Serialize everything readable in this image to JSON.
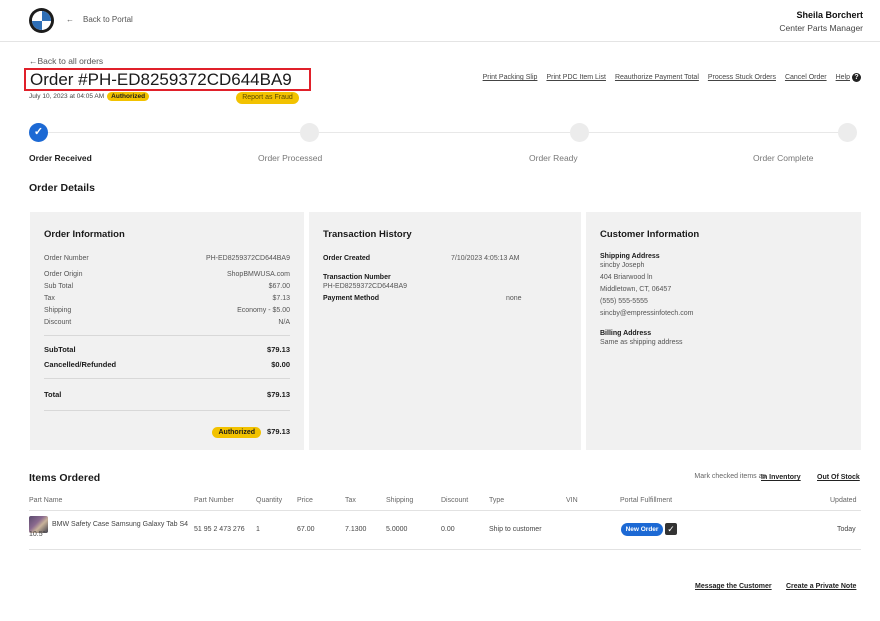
{
  "header": {
    "back_to_portal": "Back to Portal",
    "user_name": "Sheila Borchert",
    "user_role": "Center Parts Manager"
  },
  "order": {
    "back_to_orders": "Back to all orders",
    "title": "Order #PH-ED8259372CD644BA9",
    "date": "July 10, 2023 at 04:05 AM",
    "status_badge": "Authorized",
    "report_fraud": "Report as Fraud"
  },
  "actions": [
    "Print Packing Slip",
    "Print PDC Item List",
    "Reauthorize Payment Total",
    "Process Stuck Orders",
    "Cancel Order",
    "Help"
  ],
  "progress": {
    "steps": [
      "Order Received",
      "Order Processed",
      "Order Ready",
      "Order Complete"
    ],
    "completed_step_index": 0
  },
  "order_details_title": "Order Details",
  "order_info": {
    "title": "Order Information",
    "rows": [
      {
        "label": "Order Number",
        "value": "PH-ED8259372CD644BA9"
      },
      {
        "label": "Order Origin",
        "value": "ShopBMWUSA.com"
      },
      {
        "label": "Sub Total",
        "value": "$67.00"
      },
      {
        "label": "Tax",
        "value": "$7.13"
      },
      {
        "label": "Shipping",
        "value": "Economy - $5.00"
      },
      {
        "label": "Discount",
        "value": "N/A"
      }
    ],
    "subtotal_label": "SubTotal",
    "subtotal_value": "$79.13",
    "cancelled_label": "Cancelled/Refunded",
    "cancelled_value": "$0.00",
    "total_label": "Total",
    "total_value": "$79.13",
    "footer_badge": "Authorized",
    "footer_amount": "$79.13"
  },
  "transaction": {
    "title": "Transaction History",
    "created_label": "Order Created",
    "created_value": "7/10/2023 4:05:13 AM",
    "number_label": "Transaction Number",
    "number_value": "PH-ED8259372CD644BA9",
    "payment_label": "Payment Method",
    "payment_value": "none"
  },
  "customer": {
    "title": "Customer Information",
    "shipping_label": "Shipping Address",
    "shipping_lines": [
      "sincby Joseph",
      "404 Briarwood ln",
      "Middletown, CT, 06457",
      "(555) 555-5555",
      "sincby@empressinfotech.com"
    ],
    "billing_label": "Billing Address",
    "billing_text": "Same as shipping address"
  },
  "items": {
    "title": "Items Ordered",
    "mark_text": "Mark checked items as",
    "in_inventory": "In Inventory",
    "out_of_stock": "Out Of Stock",
    "columns": [
      "Part Name",
      "Part Number",
      "Quantity",
      "Price",
      "Tax",
      "Shipping",
      "Discount",
      "Type",
      "VIN",
      "Portal Fulfillment",
      "Updated"
    ],
    "row": {
      "part_name": "BMW Safety Case Samsung Galaxy Tab S4 10.5\"",
      "part_number": "51 95 2 473 276",
      "quantity": "1",
      "price": "67.00",
      "tax": "7.1300",
      "shipping": "5.0000",
      "discount": "0.00",
      "type": "Ship to customer",
      "vin": "",
      "fulfillment": "New Order",
      "updated": "Today"
    }
  },
  "footer": {
    "message_customer": "Message the Customer",
    "private_note": "Create a Private Note"
  }
}
